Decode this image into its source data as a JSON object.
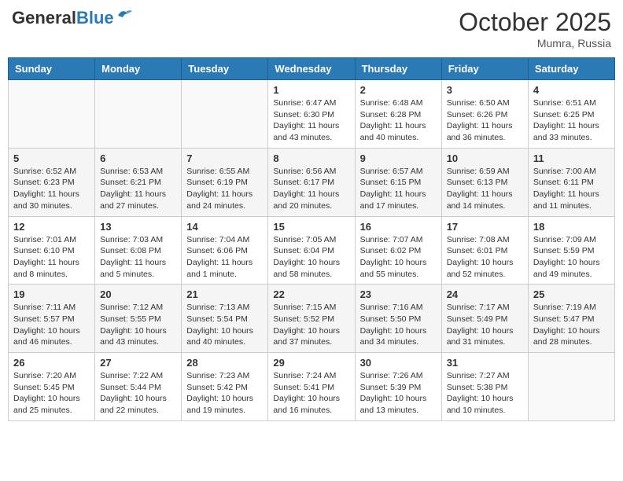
{
  "header": {
    "logo_general": "General",
    "logo_blue": "Blue",
    "month_title": "October 2025",
    "location": "Mumra, Russia"
  },
  "calendar": {
    "headers": [
      "Sunday",
      "Monday",
      "Tuesday",
      "Wednesday",
      "Thursday",
      "Friday",
      "Saturday"
    ],
    "weeks": [
      [
        {
          "day": "",
          "info": ""
        },
        {
          "day": "",
          "info": ""
        },
        {
          "day": "",
          "info": ""
        },
        {
          "day": "1",
          "info": "Sunrise: 6:47 AM\nSunset: 6:30 PM\nDaylight: 11 hours\nand 43 minutes."
        },
        {
          "day": "2",
          "info": "Sunrise: 6:48 AM\nSunset: 6:28 PM\nDaylight: 11 hours\nand 40 minutes."
        },
        {
          "day": "3",
          "info": "Sunrise: 6:50 AM\nSunset: 6:26 PM\nDaylight: 11 hours\nand 36 minutes."
        },
        {
          "day": "4",
          "info": "Sunrise: 6:51 AM\nSunset: 6:25 PM\nDaylight: 11 hours\nand 33 minutes."
        }
      ],
      [
        {
          "day": "5",
          "info": "Sunrise: 6:52 AM\nSunset: 6:23 PM\nDaylight: 11 hours\nand 30 minutes."
        },
        {
          "day": "6",
          "info": "Sunrise: 6:53 AM\nSunset: 6:21 PM\nDaylight: 11 hours\nand 27 minutes."
        },
        {
          "day": "7",
          "info": "Sunrise: 6:55 AM\nSunset: 6:19 PM\nDaylight: 11 hours\nand 24 minutes."
        },
        {
          "day": "8",
          "info": "Sunrise: 6:56 AM\nSunset: 6:17 PM\nDaylight: 11 hours\nand 20 minutes."
        },
        {
          "day": "9",
          "info": "Sunrise: 6:57 AM\nSunset: 6:15 PM\nDaylight: 11 hours\nand 17 minutes."
        },
        {
          "day": "10",
          "info": "Sunrise: 6:59 AM\nSunset: 6:13 PM\nDaylight: 11 hours\nand 14 minutes."
        },
        {
          "day": "11",
          "info": "Sunrise: 7:00 AM\nSunset: 6:11 PM\nDaylight: 11 hours\nand 11 minutes."
        }
      ],
      [
        {
          "day": "12",
          "info": "Sunrise: 7:01 AM\nSunset: 6:10 PM\nDaylight: 11 hours\nand 8 minutes."
        },
        {
          "day": "13",
          "info": "Sunrise: 7:03 AM\nSunset: 6:08 PM\nDaylight: 11 hours\nand 5 minutes."
        },
        {
          "day": "14",
          "info": "Sunrise: 7:04 AM\nSunset: 6:06 PM\nDaylight: 11 hours\nand 1 minute."
        },
        {
          "day": "15",
          "info": "Sunrise: 7:05 AM\nSunset: 6:04 PM\nDaylight: 10 hours\nand 58 minutes."
        },
        {
          "day": "16",
          "info": "Sunrise: 7:07 AM\nSunset: 6:02 PM\nDaylight: 10 hours\nand 55 minutes."
        },
        {
          "day": "17",
          "info": "Sunrise: 7:08 AM\nSunset: 6:01 PM\nDaylight: 10 hours\nand 52 minutes."
        },
        {
          "day": "18",
          "info": "Sunrise: 7:09 AM\nSunset: 5:59 PM\nDaylight: 10 hours\nand 49 minutes."
        }
      ],
      [
        {
          "day": "19",
          "info": "Sunrise: 7:11 AM\nSunset: 5:57 PM\nDaylight: 10 hours\nand 46 minutes."
        },
        {
          "day": "20",
          "info": "Sunrise: 7:12 AM\nSunset: 5:55 PM\nDaylight: 10 hours\nand 43 minutes."
        },
        {
          "day": "21",
          "info": "Sunrise: 7:13 AM\nSunset: 5:54 PM\nDaylight: 10 hours\nand 40 minutes."
        },
        {
          "day": "22",
          "info": "Sunrise: 7:15 AM\nSunset: 5:52 PM\nDaylight: 10 hours\nand 37 minutes."
        },
        {
          "day": "23",
          "info": "Sunrise: 7:16 AM\nSunset: 5:50 PM\nDaylight: 10 hours\nand 34 minutes."
        },
        {
          "day": "24",
          "info": "Sunrise: 7:17 AM\nSunset: 5:49 PM\nDaylight: 10 hours\nand 31 minutes."
        },
        {
          "day": "25",
          "info": "Sunrise: 7:19 AM\nSunset: 5:47 PM\nDaylight: 10 hours\nand 28 minutes."
        }
      ],
      [
        {
          "day": "26",
          "info": "Sunrise: 7:20 AM\nSunset: 5:45 PM\nDaylight: 10 hours\nand 25 minutes."
        },
        {
          "day": "27",
          "info": "Sunrise: 7:22 AM\nSunset: 5:44 PM\nDaylight: 10 hours\nand 22 minutes."
        },
        {
          "day": "28",
          "info": "Sunrise: 7:23 AM\nSunset: 5:42 PM\nDaylight: 10 hours\nand 19 minutes."
        },
        {
          "day": "29",
          "info": "Sunrise: 7:24 AM\nSunset: 5:41 PM\nDaylight: 10 hours\nand 16 minutes."
        },
        {
          "day": "30",
          "info": "Sunrise: 7:26 AM\nSunset: 5:39 PM\nDaylight: 10 hours\nand 13 minutes."
        },
        {
          "day": "31",
          "info": "Sunrise: 7:27 AM\nSunset: 5:38 PM\nDaylight: 10 hours\nand 10 minutes."
        },
        {
          "day": "",
          "info": ""
        }
      ]
    ]
  }
}
